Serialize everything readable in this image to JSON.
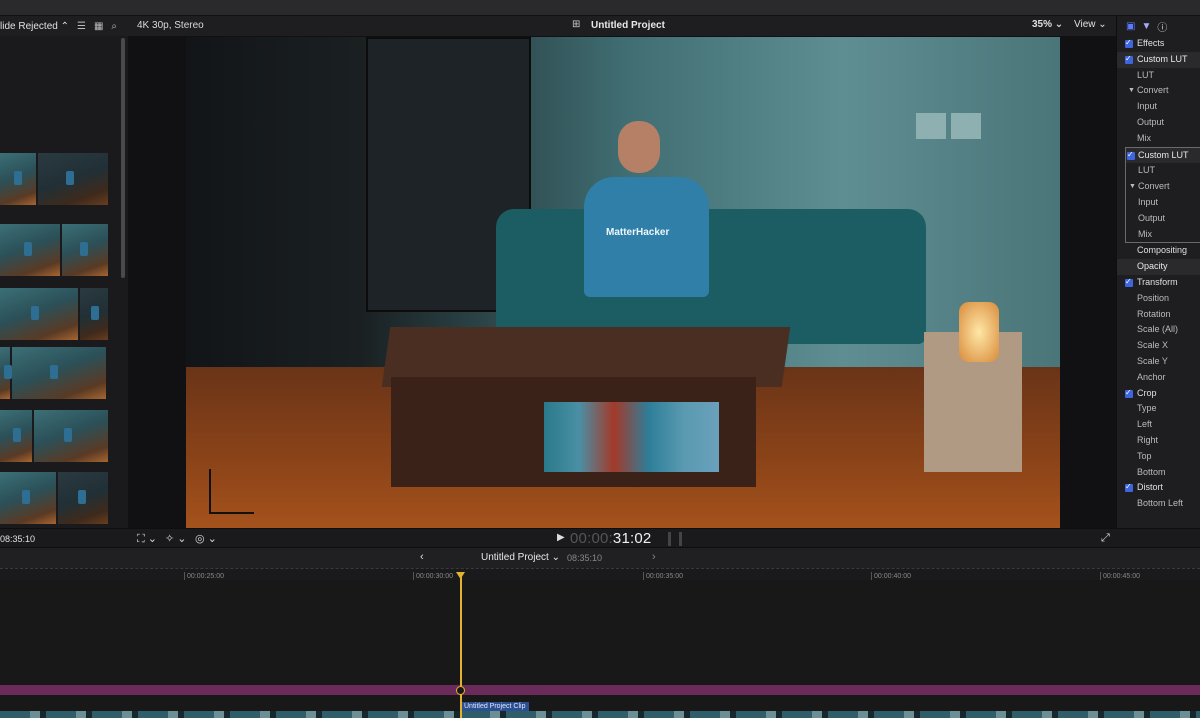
{
  "browser": {
    "filter_label": "lide Rejected",
    "duration": "08:35:10"
  },
  "viewer": {
    "format_label": "4K 30p, Stereo",
    "project_title": "Untitled Project",
    "zoom_label": "35%",
    "view_label": "View",
    "overlay_text": "MatterHacker"
  },
  "inspector": {
    "rows": [
      {
        "label": "Effects",
        "kind": "sec",
        "checked": true
      },
      {
        "label": "Custom LUT",
        "kind": "header",
        "checked": true
      },
      {
        "label": "LUT",
        "kind": "sub"
      },
      {
        "label": "Convert",
        "kind": "grp"
      },
      {
        "label": "Input",
        "kind": "sub"
      },
      {
        "label": "Output",
        "kind": "sub"
      },
      {
        "label": "Mix",
        "kind": "sub"
      },
      {
        "label": "Custom LUT",
        "kind": "header",
        "checked": true
      },
      {
        "label": "LUT",
        "kind": "sub"
      },
      {
        "label": "Convert",
        "kind": "grp"
      },
      {
        "label": "Input",
        "kind": "sub"
      },
      {
        "label": "Output",
        "kind": "sub"
      },
      {
        "label": "Mix",
        "kind": "sub"
      },
      {
        "label": "Compositing",
        "kind": "sec"
      },
      {
        "label": "Opacity",
        "kind": "header"
      },
      {
        "label": "Transform",
        "kind": "sec",
        "checked": true
      },
      {
        "label": "Position",
        "kind": "sub"
      },
      {
        "label": "Rotation",
        "kind": "sub"
      },
      {
        "label": "Scale (All)",
        "kind": "sub"
      },
      {
        "label": "Scale X",
        "kind": "sub"
      },
      {
        "label": "Scale Y",
        "kind": "sub"
      },
      {
        "label": "Anchor",
        "kind": "sub"
      },
      {
        "label": "Crop",
        "kind": "sec",
        "checked": true
      },
      {
        "label": "Type",
        "kind": "sub"
      },
      {
        "label": "Left",
        "kind": "sub"
      },
      {
        "label": "Right",
        "kind": "sub"
      },
      {
        "label": "Top",
        "kind": "sub"
      },
      {
        "label": "Bottom",
        "kind": "sub"
      },
      {
        "label": "Distort",
        "kind": "sec",
        "checked": true
      },
      {
        "label": "Bottom Left",
        "kind": "sub"
      }
    ]
  },
  "playback": {
    "timecode_dim": "00:00:",
    "timecode_live": "31:02"
  },
  "timeline": {
    "project_name": "Untitled Project",
    "project_length": "08:35:10",
    "ruler_ticks": [
      "00:00:25:00",
      "00:00:30:00",
      "00:00:35:00",
      "00:00:40:00",
      "00:00:45:00"
    ],
    "clip_label": "Untitled Project Clip"
  },
  "icons": {
    "browser_bar": [
      "list-view-icon",
      "filmstrip-icon",
      "search-icon"
    ],
    "inspector_tabs": [
      "video-inspector-icon",
      "filter-icon",
      "info-icon"
    ]
  },
  "colors": {
    "accent_checkbox": "#3f64e0",
    "playhead": "#e3b22c",
    "purple_track": "#6a2b5a",
    "clip_label_bg": "#2b4f8f"
  }
}
